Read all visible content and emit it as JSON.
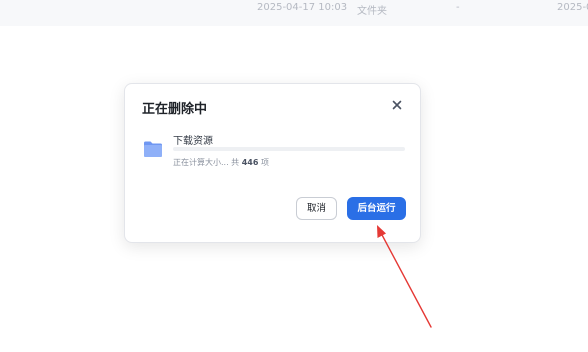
{
  "background_row": {
    "modified": "2025-04-17 10:03",
    "type": "文件夹",
    "size": "-",
    "created": "2025-0"
  },
  "dialog": {
    "title": "正在删除中",
    "close_icon": "close-icon",
    "item": {
      "icon": "folder-icon",
      "name": "下载资源",
      "progress": 0,
      "status_prefix": "正在计算大小... 共",
      "status_count": "446",
      "status_suffix": "项"
    },
    "buttons": {
      "cancel": "取消",
      "background": "后台运行"
    }
  },
  "colors": {
    "primary": "#2a6fe6",
    "folder": "#7ea4f7",
    "annotation": "#e53935"
  }
}
